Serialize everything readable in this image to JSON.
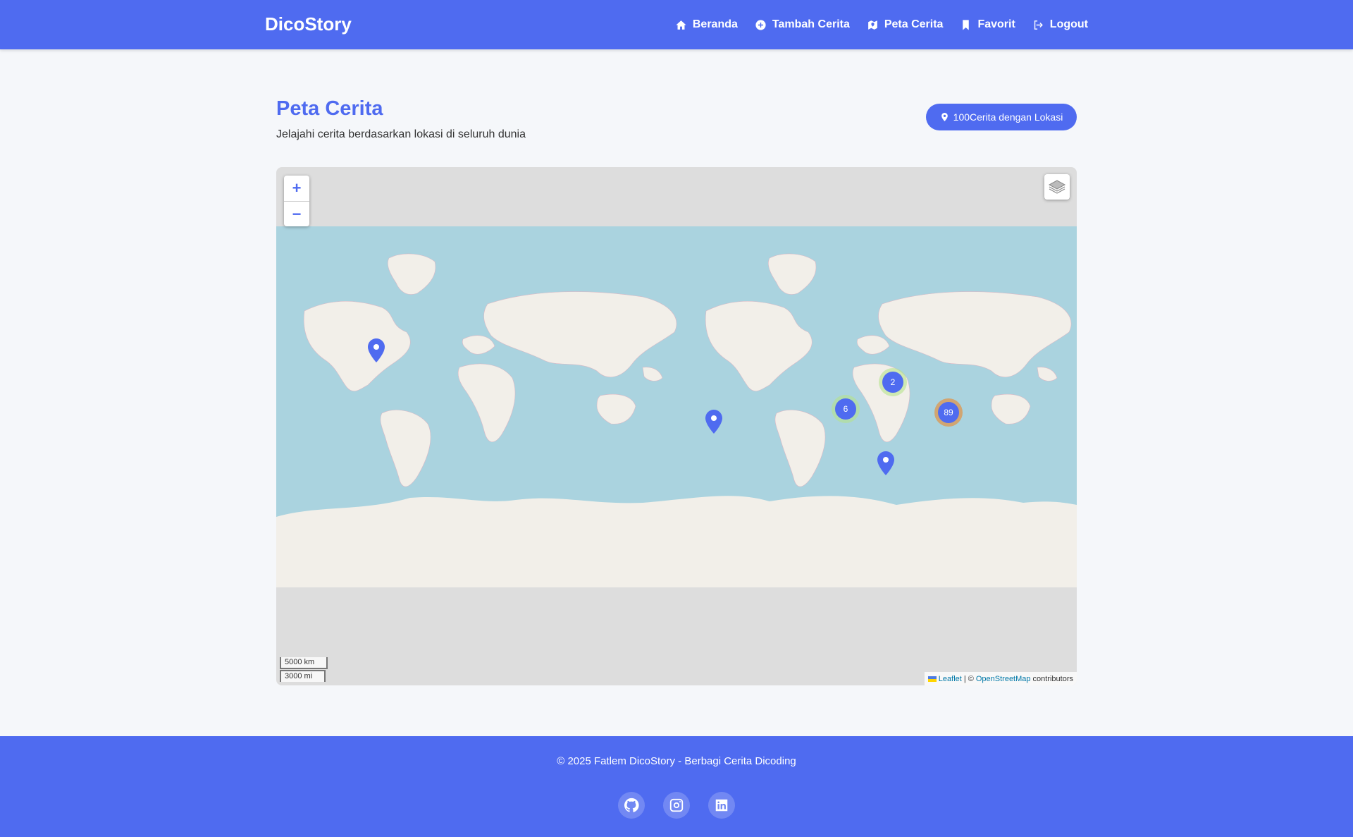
{
  "app": {
    "brand": "DicoStory"
  },
  "nav": {
    "items": [
      {
        "label": "Beranda",
        "icon": "home-icon"
      },
      {
        "label": "Tambah Cerita",
        "icon": "plus-circle-icon"
      },
      {
        "label": "Peta Cerita",
        "icon": "map-icon"
      },
      {
        "label": "Favorit",
        "icon": "bookmark-icon"
      },
      {
        "label": "Logout",
        "icon": "logout-icon"
      }
    ]
  },
  "page": {
    "title": "Peta Cerita",
    "subtitle": "Jelajahi cerita berdasarkan lokasi di seluruh dunia",
    "badge": "100Cerita dengan Lokasi"
  },
  "map": {
    "zoom_in": "+",
    "zoom_out": "−",
    "scale_km": "5000 km",
    "scale_mi": "3000 mi",
    "attribution": {
      "leaflet": "Leaflet",
      "separator": "| ©",
      "osm": "OpenStreetMap",
      "contributors": "contributors"
    },
    "clusters": [
      {
        "count": "2"
      },
      {
        "count": "6"
      },
      {
        "count": "89"
      }
    ],
    "colors": {
      "land": "#f2efe9",
      "water": "#aad3df",
      "outside": "#dddddd",
      "marker": "#4f6bf0"
    }
  },
  "footer": {
    "text": "© 2025 Fatlem DicoStory - Berbagi Cerita Dicoding",
    "socials": [
      "github-icon",
      "instagram-icon",
      "linkedin-icon"
    ]
  },
  "colors": {
    "primary": "#4f6bf0",
    "background": "#f5f7fa"
  }
}
